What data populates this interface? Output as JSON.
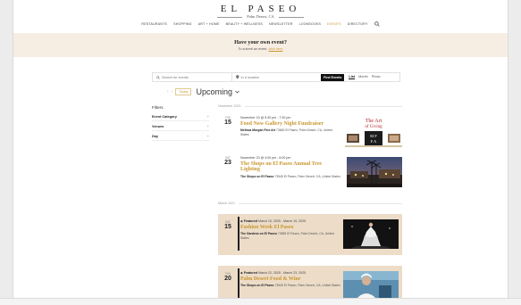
{
  "brand": {
    "name": "EL PASEO",
    "subtitle": "Palm Desert, CA"
  },
  "nav": {
    "items": [
      {
        "label": "RESTAURANTS",
        "active": false
      },
      {
        "label": "SHOPPING",
        "active": false
      },
      {
        "label": "ART + HOME",
        "active": false
      },
      {
        "label": "BEAUTY + WELLNESS",
        "active": false
      },
      {
        "label": "NEWSLETTER",
        "active": false
      },
      {
        "label": "LOOKBOOKS",
        "active": false
      },
      {
        "label": "EVENTS",
        "active": true
      },
      {
        "label": "DIRECTORY",
        "active": false
      }
    ],
    "search_icon": "search-icon"
  },
  "banner": {
    "title": "Have your own event?",
    "text_prefix": "To submit an event, ",
    "link": "click here"
  },
  "search": {
    "events_placeholder": "Search for events",
    "location_placeholder": "In a location",
    "find_button": "Find Events",
    "views": [
      "List",
      "Month",
      "Photo"
    ]
  },
  "datenav": {
    "today": "Today",
    "heading": "Upcoming"
  },
  "filters": {
    "title": "Filters",
    "items": [
      "Event Category",
      "Venues",
      "Day"
    ]
  },
  "months": [
    "November 2021",
    "March 2021"
  ],
  "events": [
    {
      "dow": "THU",
      "day": "15",
      "when": "November 15 @ 5:30 pm - 7:30 pm",
      "featured": false,
      "title": "Food Now Gallery Night Fundraiser",
      "venue_name": "Melissa Morgan Fine Art",
      "venue_address": "73660 El Paseo, Palm Desert, CA, United States",
      "image": "the-art-of-giving-poster"
    },
    {
      "dow": "SAT",
      "day": "23",
      "when": "November 23 @ 4:00 pm - 6:00 pm",
      "featured": false,
      "title": "The Shops on El Paseo Annual Tree Lighting",
      "venue_name": "The Shops on El Paseo",
      "venue_address": "73545 El Paseo, Palm Desert, CA, United States",
      "image": "palm-street-night-photo"
    },
    {
      "dow": "SAT",
      "day": "15",
      "when": "March 15, 2025 - March 19, 2025",
      "featured": true,
      "featured_label": "Featured",
      "title": "Fashion Week El Paseo",
      "venue_name": "The Gardens on El Paseo",
      "venue_address": "73585 El Paseo, Palm Desert, CA, United States",
      "image": "runway-gown-photo"
    },
    {
      "dow": "THU",
      "day": "20",
      "when": "March 22, 2025 - March 23, 2025",
      "featured": true,
      "featured_label": "Featured",
      "title": "Palm Desert Food & Wine",
      "venue_name": "The Shops on El Paseo",
      "venue_address": "73545 El Paseo, Palm Desert, CA, United States",
      "image": "chef-portrait-photo"
    }
  ],
  "colors": {
    "accent": "#c9972f",
    "banner_bg": "#f7eee3",
    "featured_bg": "#ecdcc8"
  }
}
